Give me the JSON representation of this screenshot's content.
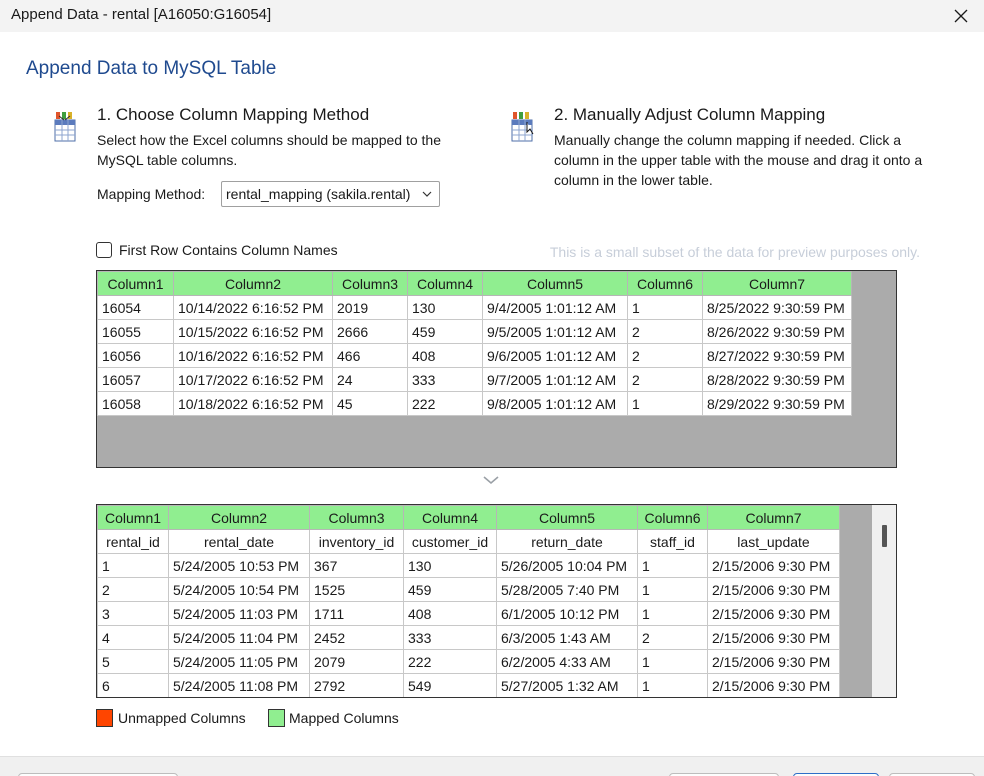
{
  "window": {
    "title": "Append Data - rental [A16050:G16054]",
    "close_icon": "close-icon"
  },
  "heading": "Append Data to MySQL Table",
  "step1": {
    "title": "1. Choose Column Mapping Method",
    "description": "Select how the Excel columns should be mapped to the MySQL table columns.",
    "mapping_label": "Mapping Method:",
    "mapping_value": "rental_mapping (sakila.rental)"
  },
  "step2": {
    "title": "2. Manually Adjust Column Mapping",
    "description": "Manually change the column mapping if needed. Click a column in the upper table with the mouse and drag it onto a column in the lower table."
  },
  "first_row_checkbox": {
    "label": "First Row Contains Column Names",
    "checked": false
  },
  "preview_note": "This is a small subset of the data for preview purposes only.",
  "source_table": {
    "headers": [
      "Column1",
      "Column2",
      "Column3",
      "Column4",
      "Column5",
      "Column6",
      "Column7"
    ],
    "rows": [
      [
        "16054",
        "10/14/2022 6:16:52 PM",
        "2019",
        "130",
        "9/4/2005 1:01:12 AM",
        "1",
        "8/25/2022 9:30:59 PM"
      ],
      [
        "16055",
        "10/15/2022 6:16:52 PM",
        "2666",
        "459",
        "9/5/2005 1:01:12 AM",
        "2",
        "8/26/2022 9:30:59 PM"
      ],
      [
        "16056",
        "10/16/2022 6:16:52 PM",
        "466",
        "408",
        "9/6/2005 1:01:12 AM",
        "2",
        "8/27/2022 9:30:59 PM"
      ],
      [
        "16057",
        "10/17/2022 6:16:52 PM",
        "24",
        "333",
        "9/7/2005 1:01:12 AM",
        "2",
        "8/28/2022 9:30:59 PM"
      ],
      [
        "16058",
        "10/18/2022 6:16:52 PM",
        "45",
        "222",
        "9/8/2005 1:01:12 AM",
        "1",
        "8/29/2022 9:30:59 PM"
      ]
    ]
  },
  "target_table": {
    "headers": [
      "Column1",
      "Column2",
      "Column3",
      "Column4",
      "Column5",
      "Column6",
      "Column7"
    ],
    "column_names": [
      "rental_id",
      "rental_date",
      "inventory_id",
      "customer_id",
      "return_date",
      "staff_id",
      "last_update"
    ],
    "rows": [
      [
        "1",
        "5/24/2005 10:53 PM",
        "367",
        "130",
        "5/26/2005 10:04 PM",
        "1",
        "2/15/2006 9:30 PM"
      ],
      [
        "2",
        "5/24/2005 10:54 PM",
        "1525",
        "459",
        "5/28/2005 7:40 PM",
        "1",
        "2/15/2006 9:30 PM"
      ],
      [
        "3",
        "5/24/2005 11:03 PM",
        "1711",
        "408",
        "6/1/2005 10:12 PM",
        "1",
        "2/15/2006 9:30 PM"
      ],
      [
        "4",
        "5/24/2005 11:04 PM",
        "2452",
        "333",
        "6/3/2005 1:43 AM",
        "2",
        "2/15/2006 9:30 PM"
      ],
      [
        "5",
        "5/24/2005 11:05 PM",
        "2079",
        "222",
        "6/2/2005 4:33 AM",
        "1",
        "2/15/2006 9:30 PM"
      ],
      [
        "6",
        "5/24/2005 11:08 PM",
        "2792",
        "549",
        "5/27/2005 1:32 AM",
        "1",
        "2/15/2006 9:30 PM"
      ]
    ]
  },
  "legend": {
    "unmapped": {
      "label": "Unmapped Columns",
      "color": "#ff4500"
    },
    "mapped": {
      "label": "Mapped Columns",
      "color": "#90ee90"
    }
  },
  "colors": {
    "accent_heading": "#1f4a8f",
    "mapped_header": "#90ee90",
    "grid_background": "#ababab"
  }
}
